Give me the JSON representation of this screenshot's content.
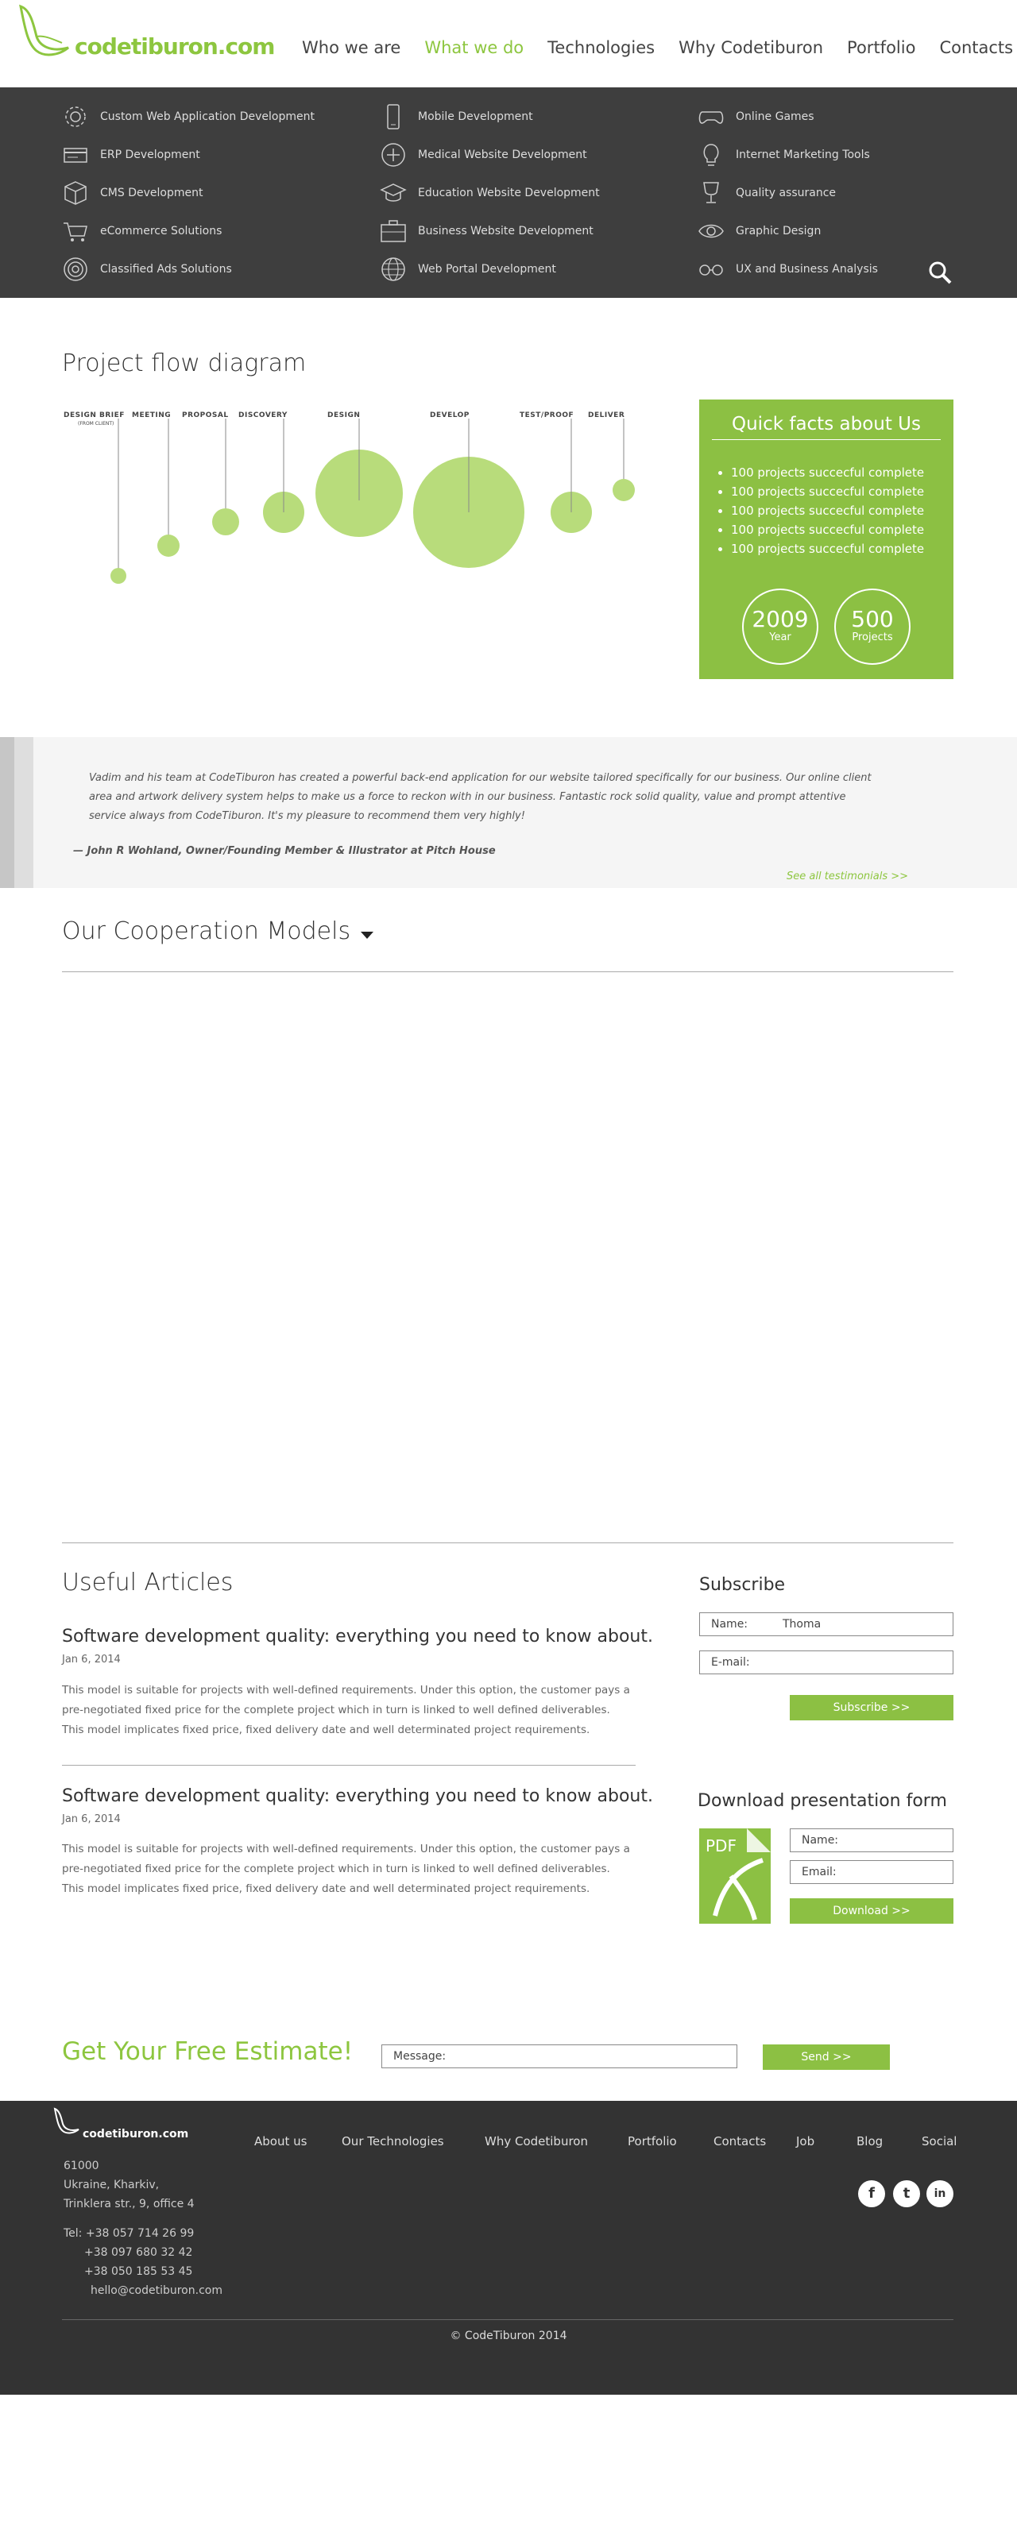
{
  "brand": {
    "logo_text": "codetiburon.com",
    "accent": "#8dc63f",
    "dark_bg": "#3e3e3e"
  },
  "nav": [
    {
      "label": "Who we are"
    },
    {
      "label": "What we do",
      "active": true
    },
    {
      "label": "Technologies"
    },
    {
      "label": "Why Codetiburon"
    },
    {
      "label": "Portfolio"
    },
    {
      "label": "Contacts"
    }
  ],
  "services": [
    {
      "label": "Custom Web Application Development",
      "icon": "gear-icon"
    },
    {
      "label": "ERP Development",
      "icon": "card-icon"
    },
    {
      "label": "CMS Development",
      "icon": "cube-icon"
    },
    {
      "label": "eCommerce Solutions",
      "icon": "cart-icon"
    },
    {
      "label": "Classified Ads Solutions",
      "icon": "target-icon"
    },
    {
      "label": "Mobile Development",
      "icon": "phone-icon"
    },
    {
      "label": "Medical Website Development",
      "icon": "plus-icon"
    },
    {
      "label": "Education Website Development",
      "icon": "graduation-cap-icon"
    },
    {
      "label": "Business Website Development",
      "icon": "briefcase-icon"
    },
    {
      "label": "Web Portal Development",
      "icon": "globe-icon"
    },
    {
      "label": "Online Games",
      "icon": "gamepad-icon"
    },
    {
      "label": "Internet Marketing Tools",
      "icon": "lightbulb-icon"
    },
    {
      "label": "Quality assurance",
      "icon": "trophy-icon"
    },
    {
      "label": "Graphic Design",
      "icon": "eye-icon"
    },
    {
      "label": "UX and Business Analysis",
      "icon": "glasses-icon"
    }
  ],
  "flow": {
    "title": "Project flow diagram",
    "stages": [
      {
        "label": "DESIGN BRIEF",
        "sub": "(FROM CLIENT)"
      },
      {
        "label": "MEETING"
      },
      {
        "label": "PROPOSAL"
      },
      {
        "label": "DISCOVERY"
      },
      {
        "label": "DESIGN"
      },
      {
        "label": "DEVELOP"
      },
      {
        "label": "TEST/PROOF"
      },
      {
        "label": "DELIVER"
      }
    ]
  },
  "facts": {
    "title": "Quick facts about Us",
    "items": [
      "100 projects succecful complete",
      "100 projects succecful complete",
      "100 projects succecful complete",
      "100 projects succecful complete",
      "100 projects succecful complete"
    ],
    "stat1": {
      "value": "2009",
      "label": "Year"
    },
    "stat2": {
      "value": "500",
      "label": "Projects"
    }
  },
  "testimonial": {
    "text": "Vadim and his team at CodeTiburon has created a powerful back-end application for our website tailored specifically for our business. Our online client area and artwork delivery system helps to make us a force to reckon with in our business. Fantastic rock solid quality, value and prompt attentive service always from CodeTiburon. It's my pleasure to recommend them very highly!",
    "author": "— John R Wohland, Owner/Founding Member & Illustrator at Pitch House",
    "link": "See all testimonials >>"
  },
  "cooperation": {
    "title": "Our Cooperation Models"
  },
  "articles": {
    "title": "Useful Articles",
    "items": [
      {
        "title": "Software development quality: everything you need to know about.",
        "date": "Jan 6, 2014",
        "body": "This model is suitable for projects with well-defined requirements. Under this option, the customer pays a pre-negotiated fixed price for the complete project which in turn is linked to well defined deliverables. This model implicates fixed price, fixed delivery date and well determinated   project requirements."
      },
      {
        "title": "Software development quality: everything you need to know about.",
        "date": "Jan 6, 2014",
        "body": "This model is suitable for projects with well-defined requirements. Under this option, the customer pays a pre-negotiated fixed price for the complete project which in turn is linked to well defined deliverables. This model implicates fixed price, fixed delivery date and well determinated   project requirements."
      }
    ]
  },
  "subscribe": {
    "title": "Subscribe",
    "name_label": "Name:",
    "name_value": "Thoma",
    "email_label": "E-mail:",
    "button": "Subscribe >>"
  },
  "download": {
    "title": "Download presentation form",
    "pdf_label": "PDF",
    "name_label": "Name:",
    "email_label": "Email:",
    "button": "Download >>"
  },
  "estimate": {
    "title": "Get Your Free Estimate!",
    "message_label": "Message:",
    "button": "Send >>"
  },
  "footer": {
    "logo_text": "codetiburon.com",
    "nav": [
      "About us",
      "Our Technologies",
      "Why Codetiburon",
      "Portfolio",
      "Contacts",
      "Job",
      "Blog",
      "Social"
    ],
    "address": [
      "61000",
      "Ukraine, Kharkiv,",
      "Trinklera str., 9, office 4"
    ],
    "phones": [
      "Tel: +38 057 714 26 99",
      "+38 097 680 32 42",
      "+38 050 185 53 45",
      "hello@codetiburon.com"
    ],
    "social": [
      {
        "icon": "facebook-icon",
        "glyph": "f"
      },
      {
        "icon": "twitter-icon",
        "glyph": "t"
      },
      {
        "icon": "linkedin-icon",
        "glyph": "in"
      }
    ],
    "copyright": "© CodeTiburon 2014"
  }
}
